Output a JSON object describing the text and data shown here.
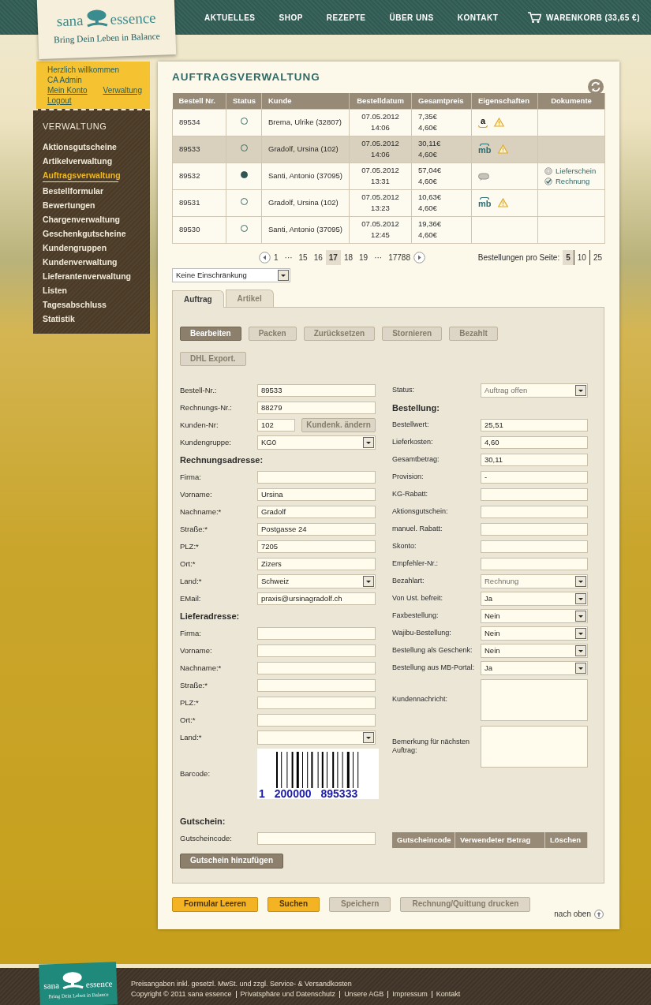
{
  "header": {
    "logo": {
      "left": "sana",
      "right": "essence",
      "tagline": "Bring Dein Leben in Balance"
    },
    "nav": [
      "AKTUELLES",
      "SHOP",
      "REZEPTE",
      "ÜBER UNS",
      "KONTAKT"
    ],
    "cart": "WARENKORB (33,65 €)"
  },
  "welcome": {
    "greeting": "Herzlich willkommen",
    "user": "CA Admin",
    "links": [
      "Mein Konto",
      "Verwaltung",
      "Logout"
    ]
  },
  "sidebar": {
    "title": "VERWALTUNG",
    "items": [
      {
        "label": "Aktionsgutscheine",
        "selected": false
      },
      {
        "label": "Artikelverwaltung",
        "selected": false
      },
      {
        "label": "Auftragsverwaltung",
        "selected": true
      },
      {
        "label": "Bestellformular",
        "selected": false
      },
      {
        "label": "Bewertungen",
        "selected": false
      },
      {
        "label": "Chargenverwaltung",
        "selected": false
      },
      {
        "label": "Geschenkgutscheine",
        "selected": false
      },
      {
        "label": "Kundengruppen",
        "selected": false
      },
      {
        "label": "Kundenverwaltung",
        "selected": false
      },
      {
        "label": "Lieferantenverwaltung",
        "selected": false
      },
      {
        "label": "Listen",
        "selected": false
      },
      {
        "label": "Tagesabschluss",
        "selected": false
      },
      {
        "label": "Statistik",
        "selected": false
      }
    ]
  },
  "title": "AUFTRAGSVERWALTUNG",
  "table": {
    "columns": [
      "Bestell Nr.",
      "Status",
      "Kunde",
      "Bestelldatum",
      "Gesamtpreis",
      "Eigenschaften",
      "Dokumente"
    ],
    "rows": [
      {
        "number": "89534",
        "filled": false,
        "customer": "Brema, Ulrike (32807)",
        "date": "07.05.2012",
        "time": "14:06",
        "price": "7,35€",
        "shipping": "4,60€",
        "properties": [
          {
            "kind": "smile_logo",
            "text": "a",
            "color": "#111111"
          },
          {
            "kind": "warning"
          }
        ],
        "documents": [],
        "selected": false
      },
      {
        "number": "89533",
        "filled": false,
        "customer": "Gradolf, Ursina (102)",
        "date": "07.05.2012",
        "time": "14:06",
        "price": "30,11€",
        "shipping": "4,60€",
        "properties": [
          {
            "kind": "arc_logo",
            "text": "mb",
            "color": "#2d6b73"
          },
          {
            "kind": "warning"
          }
        ],
        "documents": [],
        "selected": true
      },
      {
        "number": "89532",
        "filled": true,
        "customer": "Santi, Antonio (37095)",
        "date": "07.05.2012",
        "time": "13:31",
        "price": "57,04€",
        "shipping": "4,60€",
        "properties": [
          {
            "kind": "comment"
          }
        ],
        "documents": [
          {
            "label": "Lieferschein",
            "checked": false
          },
          {
            "label": "Rechnung",
            "checked": true
          }
        ],
        "selected": false
      },
      {
        "number": "89531",
        "filled": false,
        "customer": "Gradolf, Ursina (102)",
        "date": "07.05.2012",
        "time": "13:23",
        "price": "10,63€",
        "shipping": "4,60€",
        "properties": [
          {
            "kind": "arc_logo",
            "text": "mb",
            "color": "#2d6b73"
          },
          {
            "kind": "warning"
          }
        ],
        "documents": [],
        "selected": false
      },
      {
        "number": "89530",
        "filled": false,
        "customer": "Santi, Antonio (37095)",
        "date": "07.05.2012",
        "time": "12:45",
        "price": "19,36€",
        "shipping": "4,60€",
        "properties": [],
        "documents": [],
        "selected": false
      }
    ]
  },
  "pagination": {
    "pages": [
      {
        "label": "1",
        "selected": false
      },
      {
        "label": "···",
        "selected": false
      },
      {
        "label": "15",
        "selected": false
      },
      {
        "label": "16",
        "selected": false
      },
      {
        "label": "17",
        "selected": true
      },
      {
        "label": "18",
        "selected": false
      },
      {
        "label": "19",
        "selected": false
      },
      {
        "label": "···",
        "selected": false
      },
      {
        "label": "17788",
        "selected": false
      }
    ],
    "per_page_label": "Bestellungen pro Seite:",
    "per_page": [
      {
        "label": "5",
        "selected": true
      },
      {
        "label": "10",
        "selected": false
      },
      {
        "label": "25",
        "selected": false
      }
    ]
  },
  "filter": {
    "value": "Keine Einschränkung"
  },
  "tabs": [
    {
      "label": "Auftrag",
      "selected": true
    },
    {
      "label": "Artikel",
      "selected": false
    }
  ],
  "actions": [
    {
      "label": "Bearbeiten",
      "disabled": false
    },
    {
      "label": "Packen",
      "disabled": true
    },
    {
      "label": "Zurücksetzen",
      "disabled": true
    },
    {
      "label": "Stornieren",
      "disabled": true
    },
    {
      "label": "Bezahlt",
      "disabled": true
    },
    {
      "label": "DHL Export.",
      "disabled": true
    }
  ],
  "form_left": [
    {
      "kind": "text",
      "label": "Bestell-Nr.:",
      "value": "89533"
    },
    {
      "kind": "text",
      "label": "Rechnungs-Nr.:",
      "value": "88279"
    },
    {
      "kind": "text_button",
      "label": "Kunden-Nr:",
      "value": "102",
      "button": {
        "label": "Kundenk. ändern",
        "disabled": true
      }
    },
    {
      "kind": "select",
      "label": "Kundengruppe:",
      "value": "KG0",
      "disabled": false
    },
    {
      "kind": "heading",
      "label": "Rechnungsadresse:"
    },
    {
      "kind": "text",
      "label": "Firma:"
    },
    {
      "kind": "text",
      "label": "Vorname:",
      "value": "Ursina"
    },
    {
      "kind": "text",
      "label": "Nachname:*",
      "value": "Gradolf"
    },
    {
      "kind": "text",
      "label": "Straße:*",
      "value": "Postgasse 24"
    },
    {
      "kind": "text",
      "label": "PLZ:*",
      "value": "7205"
    },
    {
      "kind": "text",
      "label": "Ort:*",
      "value": "Zizers"
    },
    {
      "kind": "select",
      "label": "Land:*",
      "value": "Schweiz",
      "disabled": false
    },
    {
      "kind": "text",
      "label": "EMail:",
      "value": "praxis@ursinagradolf.ch"
    },
    {
      "kind": "heading",
      "label": "Lieferadresse:"
    },
    {
      "kind": "text",
      "label": "Firma:"
    },
    {
      "kind": "text",
      "label": "Vorname:"
    },
    {
      "kind": "text",
      "label": "Nachname:*"
    },
    {
      "kind": "text",
      "label": "Straße:*"
    },
    {
      "kind": "text",
      "label": "PLZ:*"
    },
    {
      "kind": "text",
      "label": "Ort:*"
    },
    {
      "kind": "select",
      "label": "Land:*"
    },
    {
      "kind": "barcode",
      "label": "Barcode:",
      "digits": [
        "1",
        "200000",
        "895333"
      ]
    }
  ],
  "form_right": [
    {
      "kind": "select",
      "label": "Status:",
      "value": "Auftrag offen",
      "disabled": true
    },
    {
      "kind": "heading",
      "label": "Bestellung:"
    },
    {
      "kind": "text",
      "label": "Bestellwert:",
      "value": "25,51"
    },
    {
      "kind": "text",
      "label": "Lieferkosten:",
      "value": "4,60"
    },
    {
      "kind": "text",
      "label": "Gesamtbetrag:",
      "value": "30,11"
    },
    {
      "kind": "text",
      "label": "Provision:",
      "value": "-"
    },
    {
      "kind": "text",
      "label": "KG-Rabatt:"
    },
    {
      "kind": "text",
      "label": "Aktionsgutschein:"
    },
    {
      "kind": "text",
      "label": "manuel. Rabatt:"
    },
    {
      "kind": "text",
      "label": "Skonto:"
    },
    {
      "kind": "text",
      "label": "Empfehler-Nr.:"
    },
    {
      "kind": "select",
      "label": "Bezahlart:",
      "value": "Rechnung",
      "disabled": true
    },
    {
      "kind": "select",
      "label": "Von Ust. befreit:",
      "value": "Ja",
      "disabled": false
    },
    {
      "kind": "select",
      "label": "Faxbestellung:",
      "value": "Nein",
      "disabled": false
    },
    {
      "kind": "select",
      "label": "Wajibu-Bestellung:",
      "value": "Nein",
      "disabled": false
    },
    {
      "kind": "select",
      "label": "Bestellung als Geschenk:",
      "value": "Nein",
      "disabled": false
    },
    {
      "kind": "select",
      "label": "Bestellung aus MB-Portal:",
      "value": "Ja",
      "disabled": false
    },
    {
      "kind": "textarea",
      "label": "Kundennachricht:"
    },
    {
      "kind": "textarea",
      "label": "Bemerkung für nächsten Auftrag:"
    }
  ],
  "voucher": {
    "heading": "Gutschein:",
    "label": "Gutscheincode:",
    "button": "Gutschein hinzufügen",
    "columns": [
      "Gutscheincode",
      "Verwendeter Betrag",
      "Löschen"
    ]
  },
  "bottom_buttons": [
    {
      "label": "Formular Leeren",
      "kind": "primary"
    },
    {
      "label": "Suchen",
      "kind": "primary"
    },
    {
      "label": "Speichern",
      "kind": "disabled"
    },
    {
      "label": "Rechnung/Quittung drucken",
      "kind": "disabled"
    }
  ],
  "back_to_top": "nach oben",
  "footer": {
    "logo": {
      "left": "sana",
      "right": "essence",
      "tagline": "Bring Dein Leben in Balance"
    },
    "note": "Preisangaben inkl. gesetzl. MwSt. und zzgl. Service- & Versandkosten",
    "copyright": "Copyright © 2011 sana essence",
    "links": [
      "Privatsphäre und Datenschutz",
      "Unsere AGB",
      "Impressum",
      "Kontakt"
    ]
  }
}
